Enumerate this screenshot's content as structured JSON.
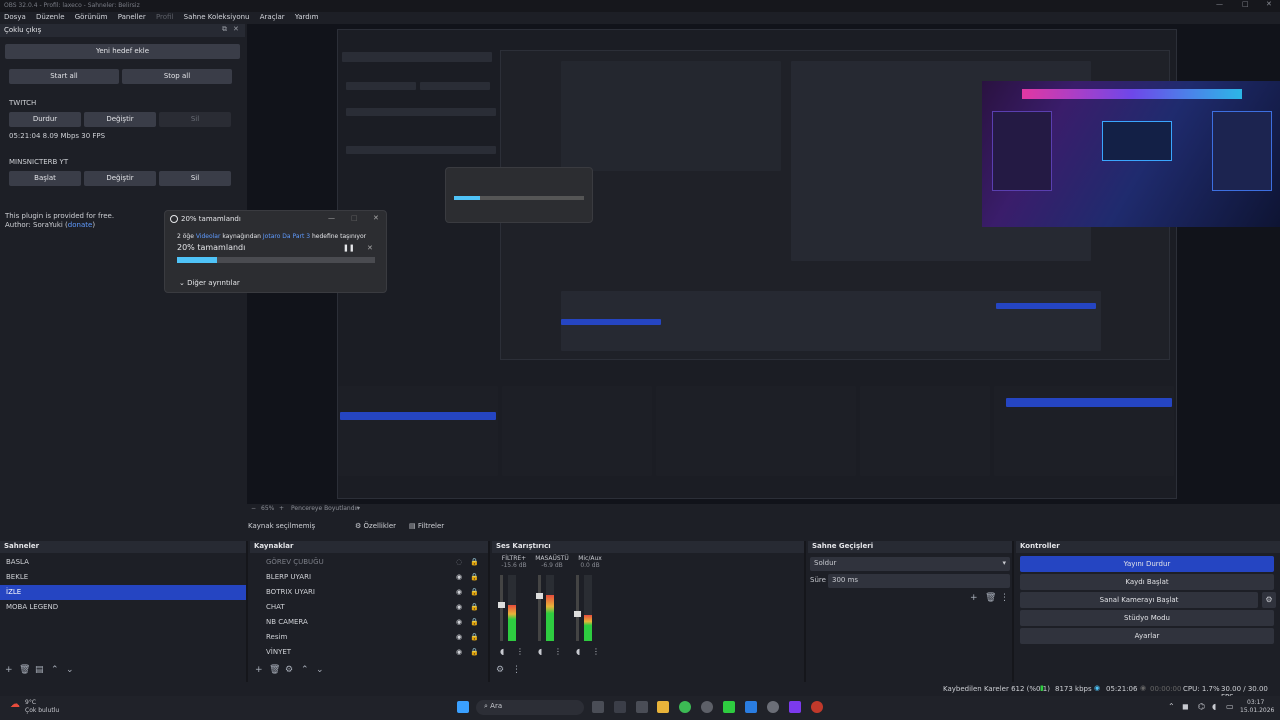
{
  "window": {
    "title": "OBS 32.0.4 - Profil: laxeco - Sahneler: Belirsiz",
    "controls": [
      "—",
      "□",
      "✕"
    ]
  },
  "menu": [
    "Dosya",
    "Düzenle",
    "Görünüm",
    "Paneller",
    "Profil",
    "Sahne Koleksiyonu",
    "Araçlar",
    "Yardım"
  ],
  "dock": {
    "title": "Çoklu çıkış",
    "new_target": "Yeni hedef ekle",
    "start_all": "Start all",
    "stop_all": "Stop all",
    "twitch": {
      "name": "TWITCH",
      "stop": "Durdur",
      "edit": "Değiştir",
      "delete": "Sil",
      "stats": "05:21:04  8.09 Mbps  30 FPS"
    },
    "yt": {
      "name": "MINSNICTERB YT",
      "start": "Başlat",
      "edit": "Değiştir",
      "delete": "Sil"
    },
    "plugin_note": "This plugin is provided for free.",
    "author_prefix": "Author: SoraYuki (",
    "author_link": "donate",
    "author_suffix": ")"
  },
  "dialog": {
    "title": "20% tamamlandı",
    "line_prefix": "2 öğe ",
    "link1": "Videolar",
    "line_mid": " kaynağından ",
    "link2": "Jotaro Da Part 3",
    "line_suffix": " hedefine taşınıyor",
    "progress_text": "20%  tamamlandı",
    "progress": 0.2,
    "more": "Diğer ayrıntılar"
  },
  "zoombar": {
    "zoom": "65%",
    "fit": "Pencereye Boyutlandır"
  },
  "sourcebar": {
    "label": "Kaynak seçilmemiş",
    "properties": "Özellikler",
    "filters": "Filtreler"
  },
  "scenes": {
    "title": "Sahneler",
    "items": [
      "BASLA",
      "BEKLE",
      "İZLE",
      "MOBA LEGEND"
    ],
    "selected": 2
  },
  "sources": {
    "title": "Kaynaklar",
    "items": [
      "GÖREV ÇUBUĞU",
      "BLERP UYARI",
      "BOTRIX UYARI",
      "CHAT",
      "NB CAMERA",
      "Resim",
      "VİNYET"
    ]
  },
  "mixer": {
    "title": "Ses Karıştırıcı",
    "channels": [
      {
        "name": "FİLTRE+",
        "db": "-15.6 dB",
        "level": 0.55
      },
      {
        "name": "MASAÜSTÜ",
        "db": "-6.9 dB",
        "level": 0.7
      },
      {
        "name": "Mic/Aux",
        "db": "0.0 dB",
        "level": 0.4
      }
    ],
    "scale": [
      "5",
      "0",
      "-5",
      "-10",
      "-15",
      "-20",
      "-25",
      "-30",
      "-35",
      "-40",
      "-45",
      "-50",
      "-55",
      "-60"
    ]
  },
  "transitions": {
    "title": "Sahne Geçişleri",
    "selected": "Soldur",
    "duration_label": "Süre",
    "duration": "300 ms"
  },
  "controls": {
    "title": "Kontroller",
    "stop_stream": "Yayını Durdur",
    "start_rec": "Kaydı Başlat",
    "virtual_cam": "Sanal Kamerayı Başlat",
    "studio": "Stüdyo Modu",
    "settings": "Ayarlar"
  },
  "status": {
    "dropped": "Kaybedilen Kareler 612 (%0.1)",
    "kbps": "8173 kbps",
    "live_time": "05:21:06",
    "rec_time": "00:00:00",
    "cpu": "CPU: 1.7%",
    "fps": "30.00 / 30.00 FPS"
  },
  "taskbar": {
    "weather_temp": "9°C",
    "weather_desc": "Çok bulutlu",
    "search": "Ara",
    "time": "03:17",
    "date": "15.01.2026"
  }
}
